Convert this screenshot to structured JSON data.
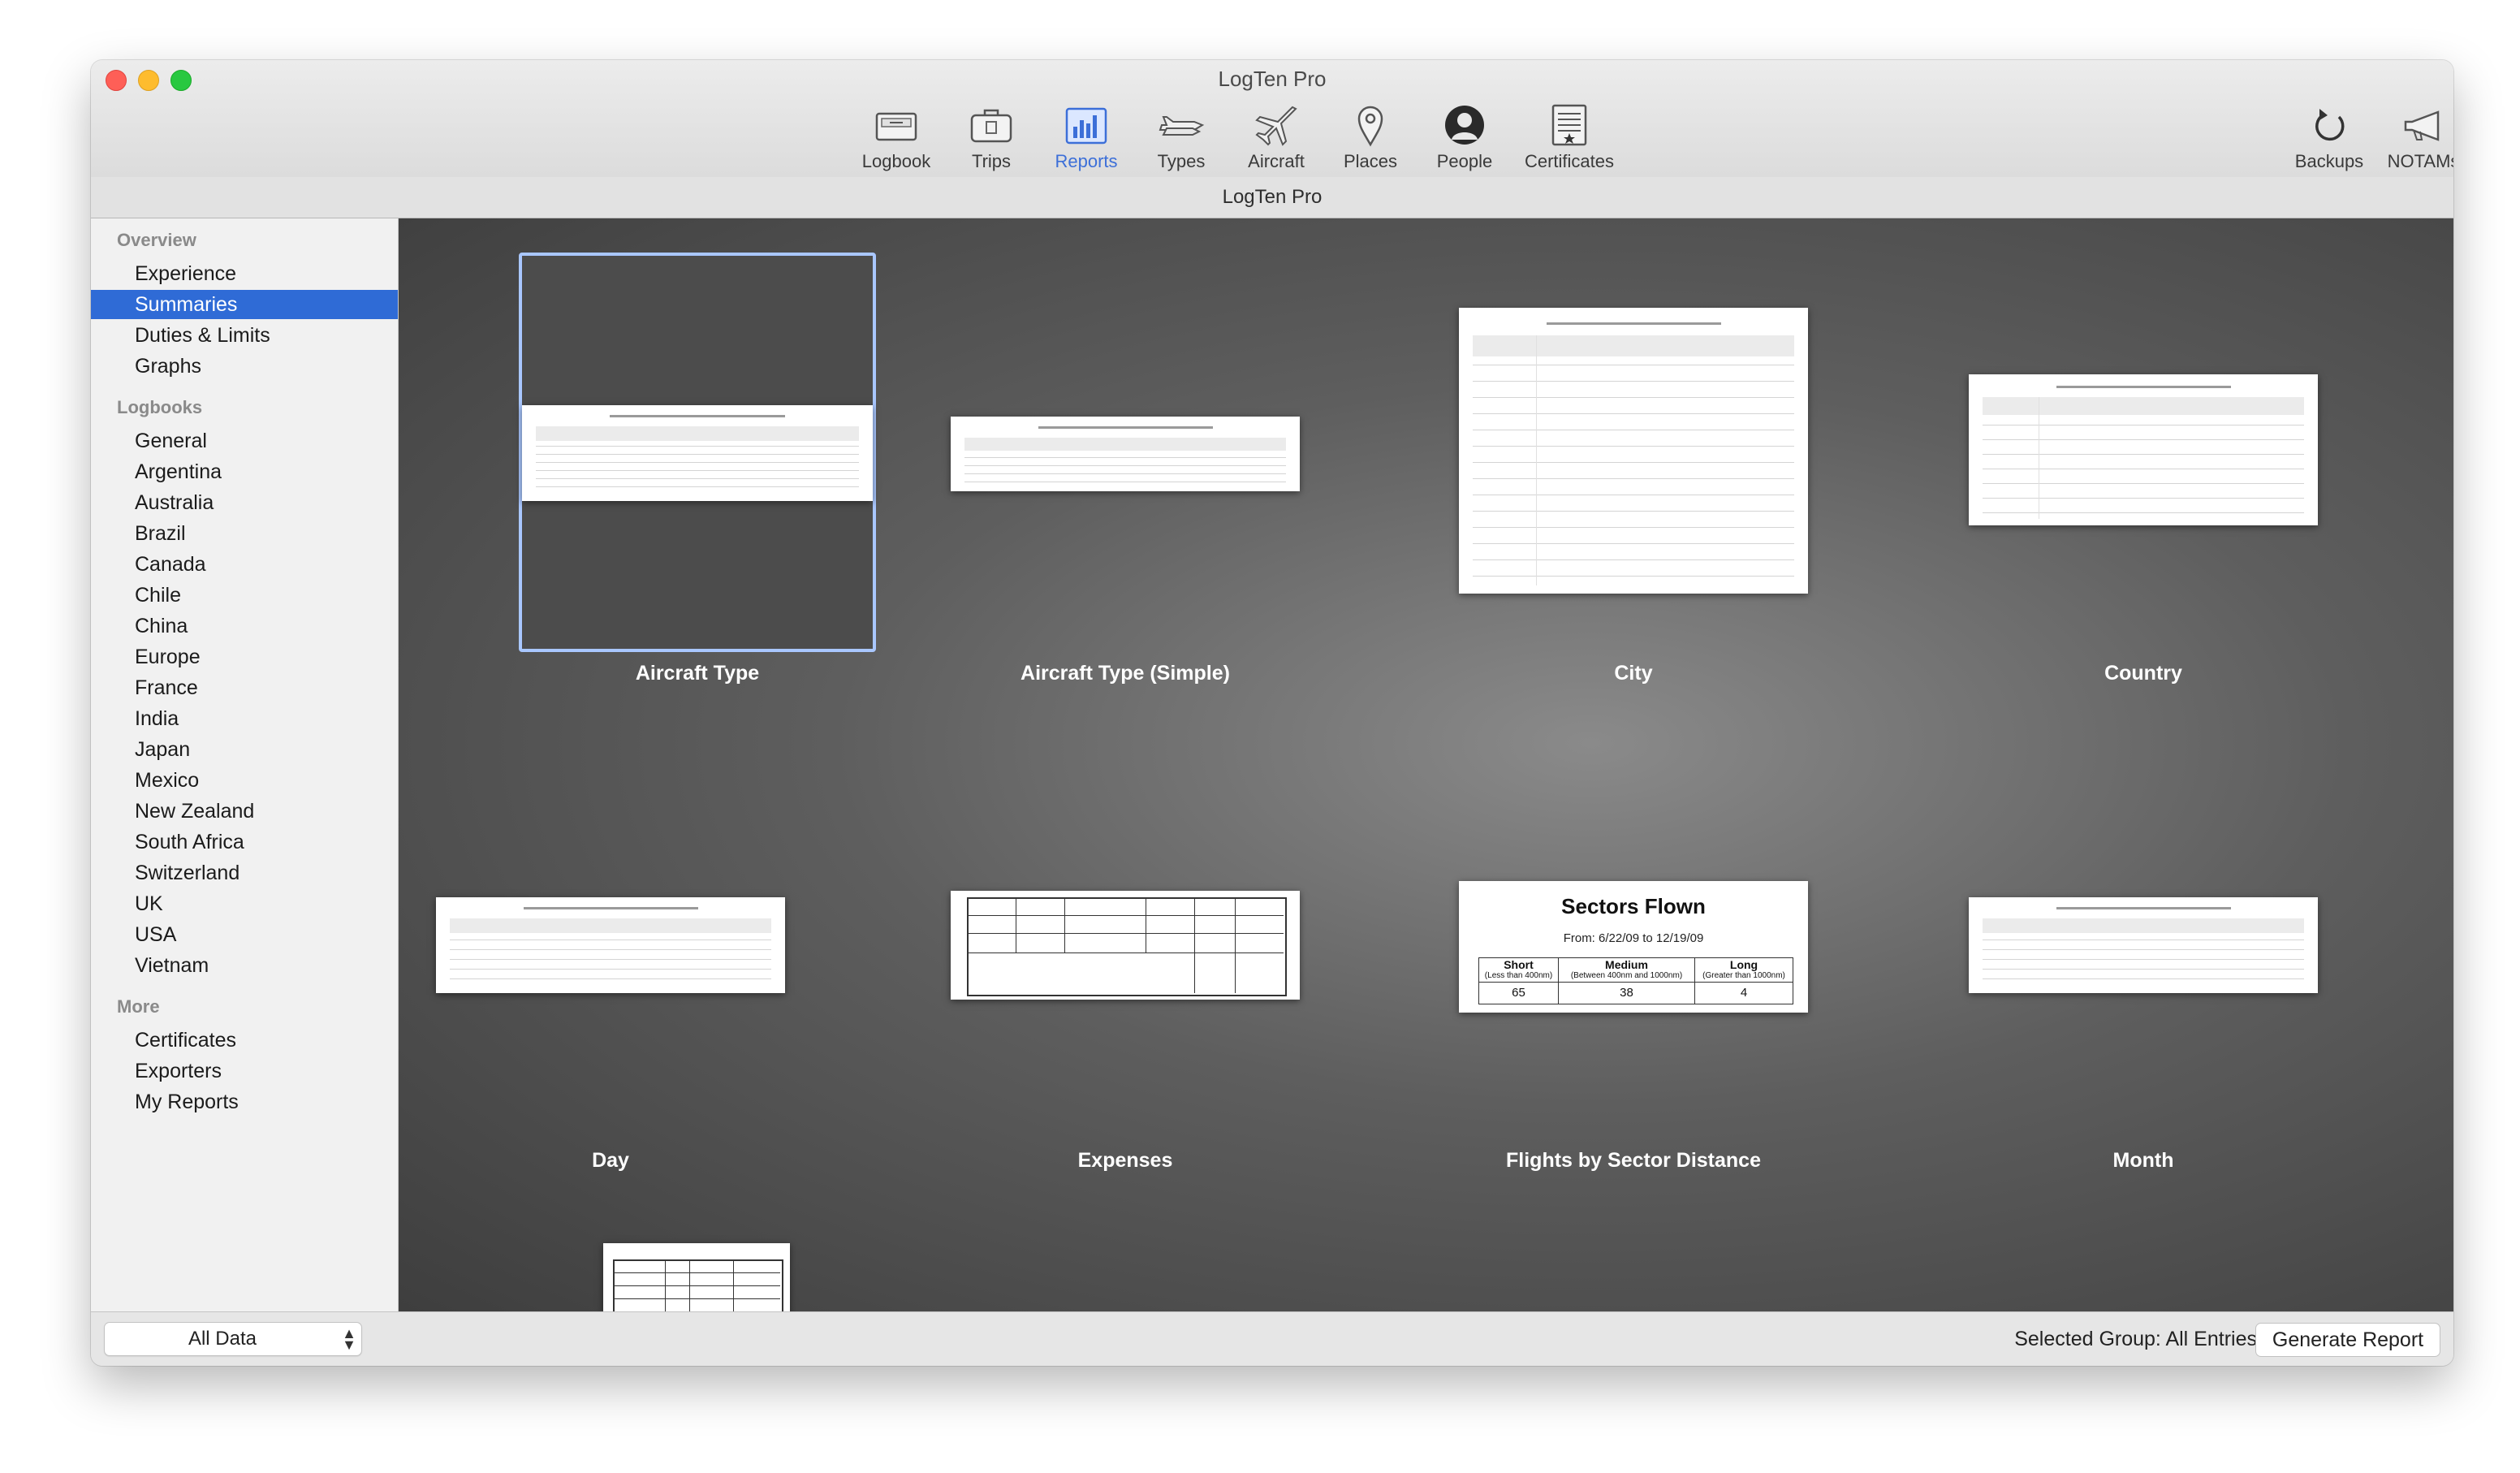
{
  "window": {
    "title": "LogTen Pro",
    "subtitle": "LogTen Pro"
  },
  "toolbar": {
    "items": [
      {
        "label": "Logbook",
        "icon": "logbook-icon"
      },
      {
        "label": "Trips",
        "icon": "trips-icon"
      },
      {
        "label": "Reports",
        "icon": "reports-icon",
        "active": true
      },
      {
        "label": "Types",
        "icon": "types-icon"
      },
      {
        "label": "Aircraft",
        "icon": "aircraft-icon"
      },
      {
        "label": "Places",
        "icon": "places-icon"
      },
      {
        "label": "People",
        "icon": "people-icon"
      },
      {
        "label": "Certificates",
        "icon": "certificates-icon"
      }
    ],
    "right_items": [
      {
        "label": "Backups",
        "icon": "backups-icon"
      },
      {
        "label": "NOTAMs",
        "icon": "notams-icon"
      }
    ],
    "accent": "#3c6fd8"
  },
  "sidebar": {
    "sections": [
      {
        "title": "Overview",
        "items": [
          "Experience",
          "Summaries",
          "Duties & Limits",
          "Graphs"
        ]
      },
      {
        "title": "Logbooks",
        "items": [
          "General",
          "Argentina",
          "Australia",
          "Brazil",
          "Canada",
          "Chile",
          "China",
          "Europe",
          "France",
          "India",
          "Japan",
          "Mexico",
          "New Zealand",
          "South Africa",
          "Switzerland",
          "UK",
          "USA",
          "Vietnam"
        ]
      },
      {
        "title": "More",
        "items": [
          "Certificates",
          "Exporters",
          "My Reports"
        ]
      }
    ],
    "selected": "Summaries",
    "selection_color": "#2f6bd6"
  },
  "reports": {
    "items": [
      "Aircraft Type",
      "Aircraft Type (Simple)",
      "City",
      "Country",
      "Day",
      "Expenses",
      "Flights by Sector Distance",
      "Month"
    ],
    "selected": "Aircraft Type"
  },
  "sectors_flown_preview": {
    "title": "Sectors Flown",
    "range": "From: 6/22/09 to 12/19/09",
    "columns": [
      {
        "name": "Short",
        "note": "(Less than 400nm)",
        "value": "65"
      },
      {
        "name": "Medium",
        "note": "(Between 400nm and 1000nm)",
        "value": "38"
      },
      {
        "name": "Long",
        "note": "(Greater than 1000nm)",
        "value": "4"
      }
    ]
  },
  "bottom": {
    "filter_value": "All Data",
    "selected_group": "Selected Group: All Entries",
    "generate_label": "Generate Report"
  }
}
